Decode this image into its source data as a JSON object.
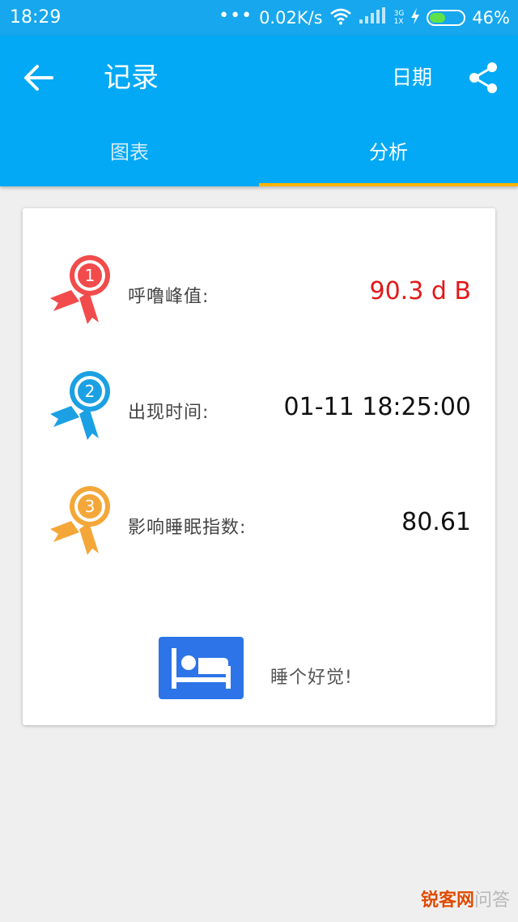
{
  "status_bar": {
    "time": "18:29",
    "dots": "•••",
    "network_speed": "0.02K/s",
    "network_type_top": "3G",
    "network_type_bottom": "1X",
    "battery": "46%",
    "battery_level": 0.46,
    "battery_color": "#5fe14a"
  },
  "app_bar": {
    "title": "记录",
    "date_label": "日期",
    "color": "#03a9f4"
  },
  "tabs": [
    {
      "label": "图表",
      "active": false
    },
    {
      "label": "分析",
      "active": true
    }
  ],
  "analysis": {
    "rows": [
      {
        "rank": "1",
        "label": "呼噜峰值:",
        "value": "90.3 d B",
        "medal_color": "#f24b4b"
      },
      {
        "rank": "2",
        "label": "出现时间:",
        "value": "01-11 18:25:00",
        "medal_color": "#1ba0e3"
      },
      {
        "rank": "3",
        "label": "影响睡眠指数:",
        "value": "80.61",
        "medal_color": "#f4a739"
      }
    ],
    "sleep_button_color": "#2d74e8",
    "sleep_text": "睡个好觉!"
  },
  "watermark": {
    "brand": "锐客网",
    "tail": "问答"
  },
  "icons": {
    "back": "arrow-left-icon",
    "share": "share-icon",
    "wifi": "wifi-icon",
    "signal": "signal-icon",
    "charging": "lightning-icon",
    "bed": "bed-icon",
    "medal": "award-ribbon-icon"
  }
}
